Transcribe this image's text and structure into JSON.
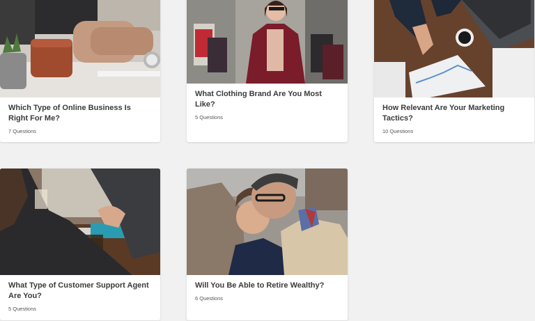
{
  "quizzes": [
    {
      "title": "Which Type of Online Business Is Right For Me?",
      "count": "7 Questions",
      "image": "workspace-laptop-image"
    },
    {
      "title": "What Clothing Brand Are You Most Like?",
      "count": "5 Questions",
      "image": "shopping-woman-image"
    },
    {
      "title": "How Relevant Are Your Marketing Tactics?",
      "count": "10 Questions",
      "image": "marketing-charts-image"
    },
    {
      "title": "What Type of Customer Support Agent Are You?",
      "count": "5 Questions",
      "image": "handshake-image"
    },
    {
      "title": "Will You Be Able to Retire Wealthy?",
      "count": "6 Questions",
      "image": "older-men-image"
    }
  ],
  "colors": {
    "page_background": "#f1f1f1",
    "card_background": "#ffffff",
    "title_text": "#3b3b3b",
    "meta_text": "#555555"
  }
}
